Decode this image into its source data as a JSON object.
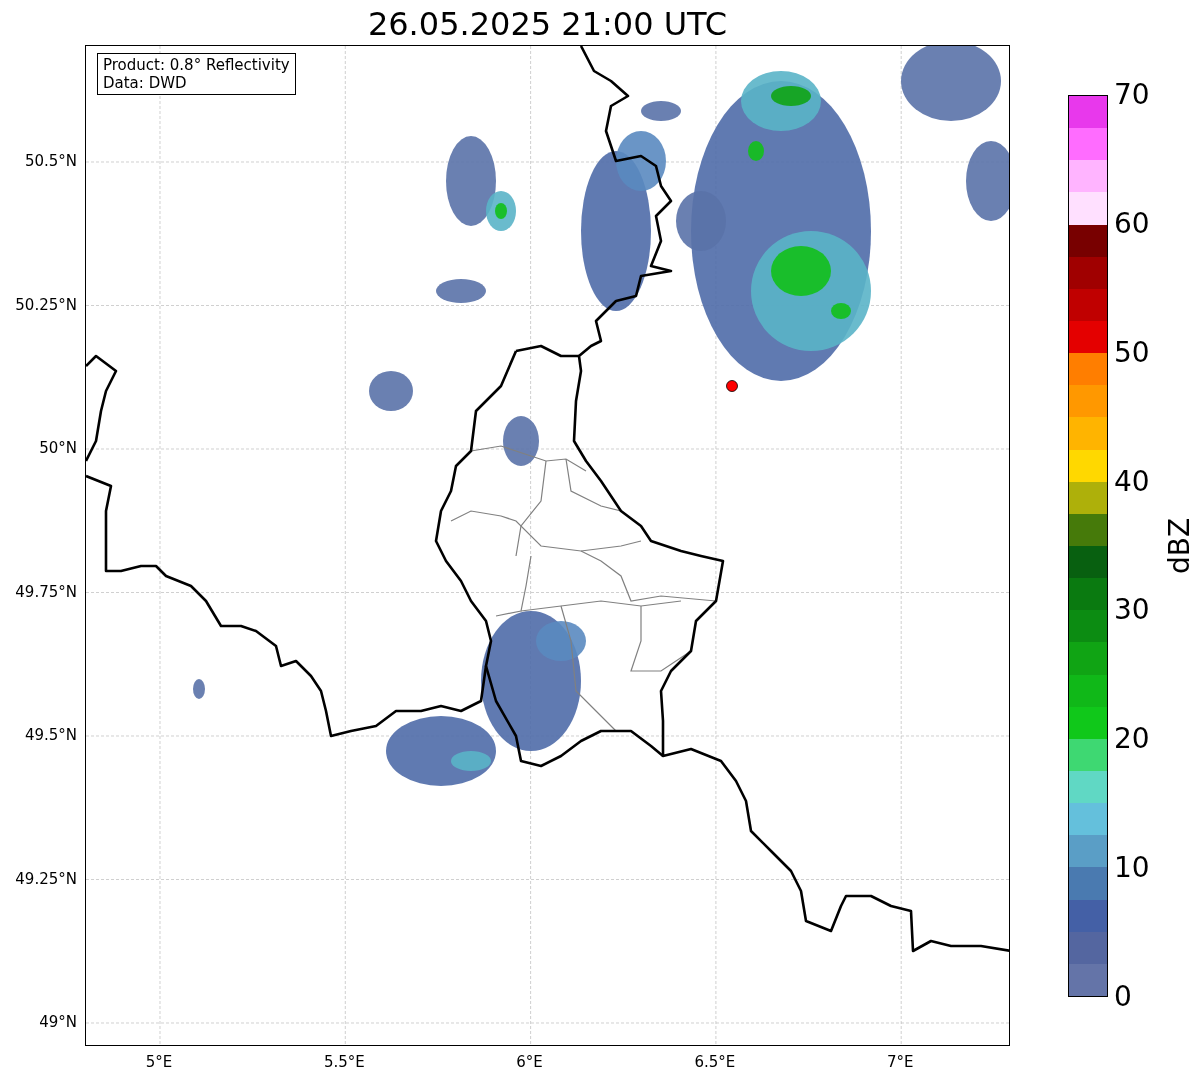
{
  "title": "26.05.2025 21:00 UTC",
  "info_box": [
    "Product: 0.8° Reflectivity",
    "Data: DWD"
  ],
  "map": {
    "xticks": [
      "5°E",
      "5.5°E",
      "6°E",
      "6.5°E",
      "7°E"
    ],
    "yticks": [
      "50.5°N",
      "50.25°N",
      "50°N",
      "49.75°N",
      "49.5°N",
      "49.25°N",
      "49°N"
    ],
    "radar_site": {
      "color": "#ff0000"
    }
  },
  "colorbar": {
    "label": "dBZ",
    "ticks": [
      "70",
      "60",
      "50",
      "40",
      "30",
      "20",
      "10",
      "0"
    ],
    "segments": [
      {
        "color": "#6474a8"
      },
      {
        "color": "#5466a0"
      },
      {
        "color": "#4460a6"
      },
      {
        "color": "#4a7ab0"
      },
      {
        "color": "#5a9ec6"
      },
      {
        "color": "#64c0dc"
      },
      {
        "color": "#60d8c4"
      },
      {
        "color": "#3ed872"
      },
      {
        "color": "#10c81a"
      },
      {
        "color": "#10b818"
      },
      {
        "color": "#10a414"
      },
      {
        "color": "#0c8c12"
      },
      {
        "color": "#0a7a10"
      },
      {
        "color": "#086010"
      },
      {
        "color": "#467a0a"
      },
      {
        "color": "#aeb00a"
      },
      {
        "color": "#ffd800"
      },
      {
        "color": "#ffb400"
      },
      {
        "color": "#ff9800"
      },
      {
        "color": "#ff7e00"
      },
      {
        "color": "#e40000"
      },
      {
        "color": "#c00000"
      },
      {
        "color": "#a00000"
      },
      {
        "color": "#780000"
      },
      {
        "color": "#ffe0ff"
      },
      {
        "color": "#ffb4ff"
      },
      {
        "color": "#ff6cff"
      },
      {
        "color": "#e838ec"
      }
    ]
  }
}
